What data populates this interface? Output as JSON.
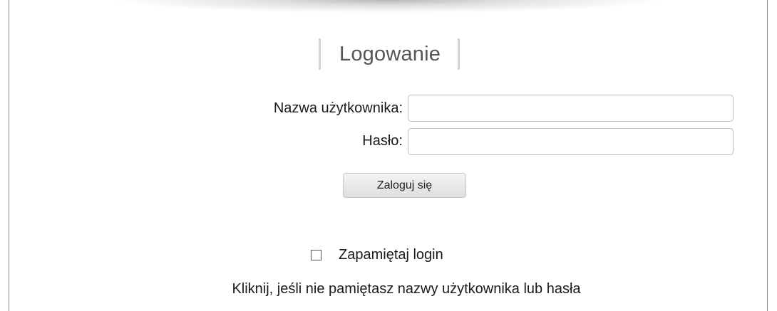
{
  "login": {
    "title": "Logowanie",
    "username_label": "Nazwa użytkownika:",
    "username_value": "",
    "password_label": "Hasło:",
    "password_value": "",
    "submit_label": "Zaloguj się",
    "remember_label": "Zapamiętaj login",
    "remember_checked": false,
    "forgot_link": "Kliknij, jeśli nie pamiętasz nazwy użytkownika lub hasła"
  }
}
